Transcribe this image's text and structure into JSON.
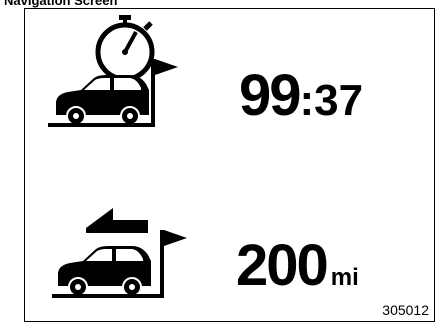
{
  "header": {
    "caption": "Navigation Screen"
  },
  "arrival_time": {
    "hours": "99",
    "separator": ":",
    "minutes": "37"
  },
  "distance": {
    "value": "200",
    "unit": "mi"
  },
  "figure_code": "305012",
  "icons": {
    "time_row": "stopwatch-car-flag-icon",
    "distance_row": "arrow-car-flag-icon"
  }
}
